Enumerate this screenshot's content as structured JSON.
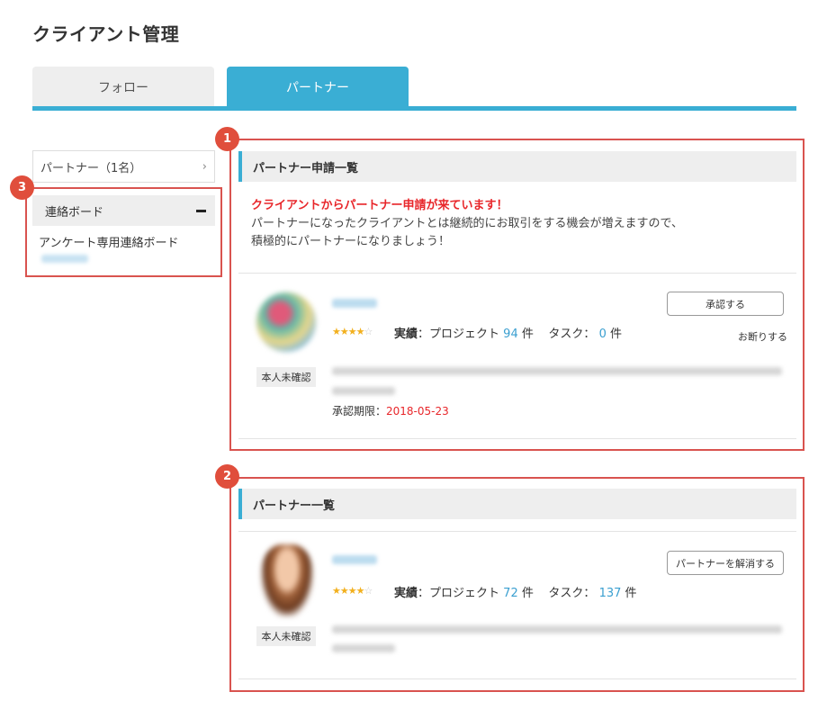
{
  "page": {
    "title": "クライアント管理"
  },
  "tabs": [
    {
      "label": "フォロー",
      "active": false
    },
    {
      "label": "パートナー",
      "active": true
    }
  ],
  "sidebar": {
    "partner_count_label": "パートナー（1名）",
    "chevron": "›",
    "board_title": "連絡ボード",
    "board_item": "アンケート専用連絡ボード"
  },
  "badges": [
    "1",
    "2",
    "3"
  ],
  "requests": {
    "title": "パートナー申請一覧",
    "notice_headline": "クライアントからパートナー申請が来ています！",
    "notice_line1": "パートナーになったクライアントとは継続的にお取引をする機会が増えますので、",
    "notice_line2": "積極的にパートナーになりましょう！",
    "item": {
      "unverified_label": "本人未確認",
      "stars": "★★★★",
      "star_empty": "☆",
      "rating": 4,
      "record_label": "実績",
      "project_label": "：プロジェクト",
      "project_count": "94",
      "unit": "件",
      "task_label": "タスク：",
      "task_count": "0",
      "deadline_label": "承認期限：",
      "deadline_value": "2018-05-23",
      "approve_label": "承認する",
      "decline_label": "お断りする"
    }
  },
  "partners": {
    "title": "パートナー一覧",
    "item": {
      "unverified_label": "本人未確認",
      "stars": "★★★★",
      "star_empty": "☆",
      "rating": 4,
      "record_label": "実績",
      "project_label": "：プロジェクト",
      "project_count": "72",
      "unit": "件",
      "task_label": "タスク：",
      "task_count": "137",
      "dissolve_label": "パートナーを解消する"
    }
  },
  "colors": {
    "accent": "#3aaed4",
    "highlight_border": "#d9534f",
    "badge": "#e04e3c",
    "alert_text": "#e8262a",
    "link_number": "#3a9fd0",
    "star": "#f2b01e"
  }
}
